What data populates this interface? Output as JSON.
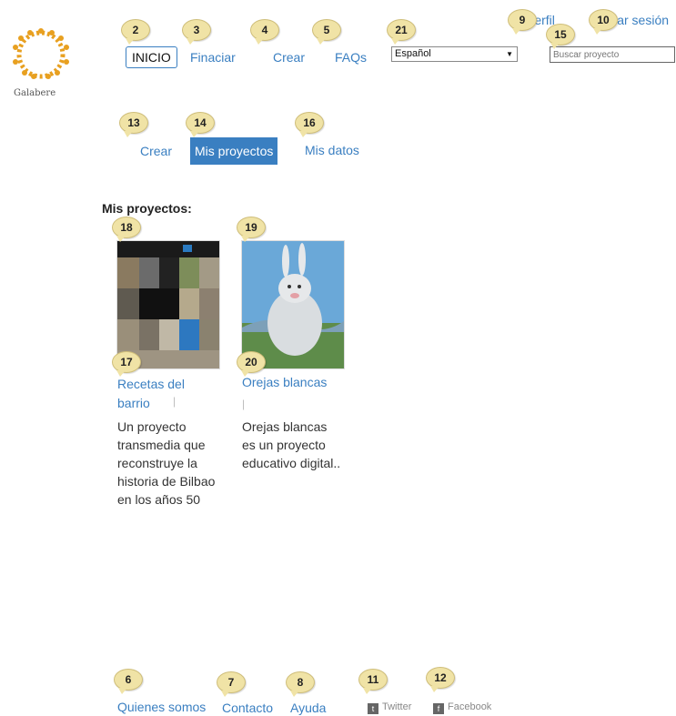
{
  "logo": {
    "caption": "Galabere"
  },
  "nav": {
    "inicio": "INICIO",
    "financiar": "Finaciar",
    "crear": "Crear",
    "faqs": "FAQs",
    "language_selected": "Español",
    "perfil": "Perfil",
    "cerrar_sesion": "Cerrar sesión",
    "search_placeholder": "Buscar proyecto"
  },
  "subnav": {
    "crear": "Crear",
    "mis_proyectos": "Mis proyectos",
    "mis_datos": "Mis datos"
  },
  "section_title": "Mis proyectos:",
  "projects": [
    {
      "title_line1": "Recetas del",
      "title_line2": "barrio",
      "divider": "|",
      "description": [
        "Un proyecto",
        "transmedia que",
        "reconstruye la",
        "historia de Bilbao",
        "en los años 50"
      ]
    },
    {
      "title_line1": "Orejas blancas",
      "divider": "|",
      "description": [
        "Orejas blancas",
        "es un proyecto",
        "educativo digital.."
      ]
    }
  ],
  "footer": {
    "quienes": "Quienes somos",
    "contacto": "Contacto",
    "ayuda": "Ayuda",
    "twitter": "Twitter",
    "facebook": "Facebook"
  },
  "markers": [
    "2",
    "3",
    "4",
    "5",
    "21",
    "9",
    "10",
    "15",
    "13",
    "14",
    "16",
    "18",
    "19",
    "17",
    "20",
    "6",
    "7",
    "8",
    "11",
    "12"
  ],
  "colors": {
    "link": "#3a7fc1",
    "active_tab": "#3a7fc1",
    "marker": "#f0e3a6"
  }
}
